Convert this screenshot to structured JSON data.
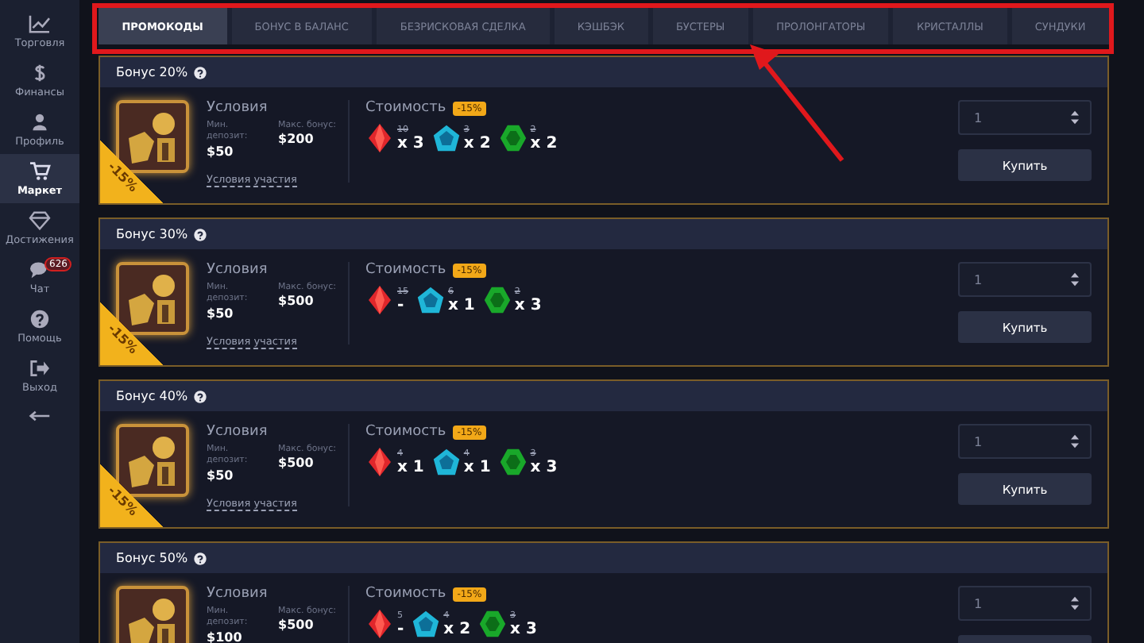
{
  "sidebar": {
    "items": [
      {
        "label": "Торговля",
        "kind": "chart",
        "selected": false
      },
      {
        "label": "Финансы",
        "kind": "dollar",
        "selected": false
      },
      {
        "label": "Профиль",
        "kind": "user",
        "selected": false
      },
      {
        "label": "Маркет",
        "kind": "cart",
        "selected": true
      },
      {
        "label": "Достижения",
        "kind": "diamond",
        "selected": false
      },
      {
        "label": "Чат",
        "kind": "chat",
        "selected": false,
        "badge": "626"
      },
      {
        "label": "Помощь",
        "kind": "help",
        "selected": false
      },
      {
        "label": "Выход",
        "kind": "exit",
        "selected": false
      }
    ]
  },
  "tabs": [
    {
      "label": "ПРОМОКОДЫ",
      "selected": true
    },
    {
      "label": "БОНУС В БАЛАНС",
      "selected": false
    },
    {
      "label": "БЕЗРИСКОВАЯ СДЕЛКА",
      "selected": false
    },
    {
      "label": "КЭШБЭК",
      "selected": false
    },
    {
      "label": "БУСТЕРЫ",
      "selected": false
    },
    {
      "label": "ПРОЛОНГАТОРЫ",
      "selected": false
    },
    {
      "label": "КРИСТАЛЛЫ",
      "selected": false
    },
    {
      "label": "СУНДУКИ",
      "selected": false
    }
  ],
  "cards": [
    {
      "title": "Бонус 20%",
      "ribbon": "-15%",
      "conditions_title": "Условия",
      "min_label": "Мин. депозит:",
      "min_value": "$50",
      "max_label": "Макс. бонус:",
      "max_value": "$200",
      "terms_link": "Условия участия",
      "cost_title": "Стоимость",
      "discount": "-15%",
      "gems": [
        {
          "kind": "ruby",
          "old": "10",
          "struck": true,
          "count": "x 3"
        },
        {
          "kind": "sapphire",
          "old": "3",
          "struck": true,
          "count": "x 2"
        },
        {
          "kind": "emerald",
          "old": "2",
          "struck": true,
          "count": "x 2"
        }
      ],
      "quantity": "1",
      "buy": "Купить"
    },
    {
      "title": "Бонус 30%",
      "ribbon": "-15%",
      "conditions_title": "Условия",
      "min_label": "Мин. депозит:",
      "min_value": "$50",
      "max_label": "Макс. бонус:",
      "max_value": "$500",
      "terms_link": "Условия участия",
      "cost_title": "Стоимость",
      "discount": "-15%",
      "gems": [
        {
          "kind": "ruby",
          "old": "15",
          "struck": true,
          "count": "-"
        },
        {
          "kind": "sapphire",
          "old": "6",
          "struck": true,
          "count": "x 1"
        },
        {
          "kind": "emerald",
          "old": "2",
          "struck": true,
          "count": "x 3"
        }
      ],
      "quantity": "1",
      "buy": "Купить"
    },
    {
      "title": "Бонус 40%",
      "ribbon": "-15%",
      "conditions_title": "Условия",
      "min_label": "Мин. депозит:",
      "min_value": "$50",
      "max_label": "Макс. бонус:",
      "max_value": "$500",
      "terms_link": "Условия участия",
      "cost_title": "Стоимость",
      "discount": "-15%",
      "gems": [
        {
          "kind": "ruby",
          "old": "4",
          "struck": true,
          "count": "x 1"
        },
        {
          "kind": "sapphire",
          "old": "4",
          "struck": true,
          "count": "x 1"
        },
        {
          "kind": "emerald",
          "old": "3",
          "struck": true,
          "count": "x 3"
        }
      ],
      "quantity": "1",
      "buy": "Купить"
    },
    {
      "title": "Бонус 50%",
      "conditions_title": "Условия",
      "min_label": "Мин. депозит:",
      "min_value": "$100",
      "max_label": "Макс. бонус:",
      "max_value": "$500",
      "cost_title": "Стоимость",
      "discount": "-15%",
      "gems": [
        {
          "kind": "ruby",
          "old": "5",
          "struck": false,
          "count": "-"
        },
        {
          "kind": "sapphire",
          "old": "4",
          "struck": true,
          "count": "x 2"
        },
        {
          "kind": "emerald",
          "old": "3",
          "struck": true,
          "count": "x 3"
        }
      ],
      "quantity": "1"
    }
  ]
}
